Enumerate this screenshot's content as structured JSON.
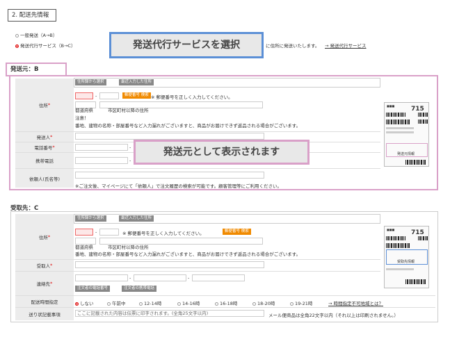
{
  "section_title": "2. 配送先情報",
  "shipping_options": {
    "option1": "一般発送（A→B）",
    "option2": "発送代行サービス（B→C）",
    "option2_suffix": "に住所に発送いたします。",
    "option2_link": "→ 発送代行サービス"
  },
  "callout_service": "発送代行サービスを選択",
  "callout_sender": "発送元として表示されます",
  "sender": {
    "title": "発送元：B",
    "btn_addressbook": "住所録から選択",
    "btn_recent": "最近入力した住所",
    "address_label": "住所",
    "postal_search": "郵便番号 検索",
    "postal_error": "※ 郵便番号を正しく入力してください。",
    "hint_prefecture": "都道府県",
    "hint_city": "市区町村以降の住所",
    "notice_title": "注意！",
    "notice_text": "番地、建物の名称・部屋番号など入力漏れがございますと、商品がお届けできず返品される場合がございます。",
    "name_label": "発送人",
    "phone_label": "電話番号",
    "mobile_label": "携帯電話",
    "client_label": "依頼人(氏名等)",
    "client_note": "※ご注文後、マイページにて「依頼人」で注文履歴の検索が可能です。顧客管理等にご利用ください。",
    "label_image": {
      "number": "715",
      "tag": "発送元情報"
    }
  },
  "receiver": {
    "title": "受取先：C",
    "btn_addressbook": "住所録から選択",
    "btn_recent": "最近入力した住所",
    "address_label": "住所",
    "postal_error": "※ 郵便番号を正しく入力してください。",
    "postal_search": "郵便番号 検索",
    "hint_prefecture": "都道府県",
    "hint_city": "市区町村以降の住所",
    "notice_text": "番地、建物の名称・部屋番号など入力漏れがございますと、商品がお届けできず返品される場合がございます。",
    "name_label": "受取人",
    "contact_label": "連絡先",
    "btn_orderer_phone": "注文者の電話番号",
    "btn_orderer_mobile": "注文者の携帯電話",
    "time_label": "配送時間指定",
    "time_options": [
      "しない",
      "午前中",
      "12-14時",
      "14-16時",
      "16-18時",
      "18-20時",
      "19-21時"
    ],
    "time_link": "→ 時間指定不可地域とは？",
    "note_label": "送り状記載事項",
    "note_placeholder": "ここに記載された内容は伝票に印字されます。(全角25文字以内)",
    "note_warning": "メール便商品は全角22文字以内（それ以上は印刷されません。）",
    "label_image": {
      "number": "715",
      "tag": "受取先情報"
    }
  },
  "colors": {
    "accent_blue": "#5b8fd6",
    "accent_pink": "#d9a0c8",
    "error_red": "#dd0000",
    "button_orange": "#f08a00"
  }
}
